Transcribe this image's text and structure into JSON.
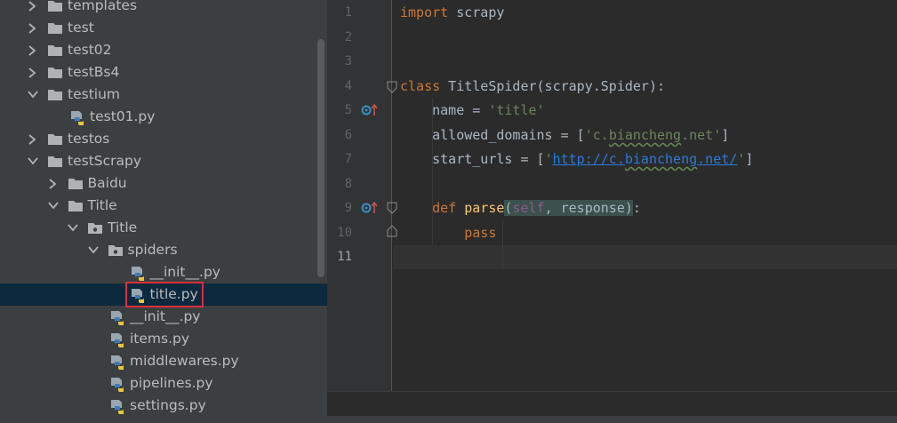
{
  "project_tree": {
    "items": [
      {
        "name": "templates",
        "type": "folder",
        "depth": 1,
        "expanded": false
      },
      {
        "name": "test",
        "type": "folder",
        "depth": 1,
        "expanded": false
      },
      {
        "name": "test02",
        "type": "folder",
        "depth": 1,
        "expanded": false
      },
      {
        "name": "testBs4",
        "type": "folder",
        "depth": 1,
        "expanded": false
      },
      {
        "name": "testium",
        "type": "folder",
        "depth": 1,
        "expanded": true
      },
      {
        "name": "test01.py",
        "type": "python-file",
        "depth": 2
      },
      {
        "name": "testos",
        "type": "folder",
        "depth": 1,
        "expanded": false
      },
      {
        "name": "testScrapy",
        "type": "folder",
        "depth": 1,
        "expanded": true
      },
      {
        "name": "Baidu",
        "type": "folder",
        "depth": 2,
        "expanded": false
      },
      {
        "name": "Title",
        "type": "folder",
        "depth": 2,
        "expanded": true
      },
      {
        "name": "Title",
        "type": "package",
        "depth": 3,
        "expanded": true
      },
      {
        "name": "spiders",
        "type": "package",
        "depth": 4,
        "expanded": true
      },
      {
        "name": "__init__.py",
        "type": "python-file",
        "depth": 5
      },
      {
        "name": "title.py",
        "type": "python-file",
        "depth": 5,
        "selected": true,
        "highlighted": true
      },
      {
        "name": "__init__.py",
        "type": "python-file",
        "depth": 4
      },
      {
        "name": "items.py",
        "type": "python-file",
        "depth": 4
      },
      {
        "name": "middlewares.py",
        "type": "python-file",
        "depth": 4
      },
      {
        "name": "pipelines.py",
        "type": "python-file",
        "depth": 4
      },
      {
        "name": "settings.py",
        "type": "python-file",
        "depth": 4
      }
    ]
  },
  "editor": {
    "line_numbers": [
      "1",
      "2",
      "3",
      "4",
      "5",
      "6",
      "7",
      "8",
      "9",
      "10",
      "11"
    ],
    "current_line": "11",
    "code": {
      "l1_kw": "import",
      "l1_rest": " scrapy",
      "l4_kw": "class",
      "l4_rest": " TitleSpider(scrapy.Spider):",
      "l5_a": "    name = ",
      "l5_str": "'title'",
      "l6_a": "    allowed_domains = [",
      "l6_q1": "'c.",
      "l6_wavy": "biancheng",
      "l6_q2": ".net'",
      "l6_b": "]",
      "l7_a": "    start_urls = [",
      "l7_q1": "'",
      "l7_link_a": "http://c.",
      "l7_link_wavy": "biancheng",
      "l7_link_b": ".net/",
      "l7_q2": "'",
      "l7_b": "]",
      "l9_kw": "    def",
      "l9_name": " parse",
      "l9_open": "(",
      "l9_self": "self",
      "l9_args": ", response",
      "l9_close": ")",
      "l9_colon": ":",
      "l10_kw": "        pass"
    }
  },
  "colors": {
    "tree_bg": "#3c3f41",
    "selection": "#0d293e",
    "highlight_box": "#d9303a",
    "editor_bg": "#2b2b2b",
    "keyword": "#cc7832",
    "string": "#6a8759",
    "self": "#94558d"
  },
  "icons": {
    "folder": "folder-icon",
    "package": "package-icon",
    "python-file": "python-file-icon",
    "override": "override-method-icon",
    "fold": "fold-marker-icon"
  }
}
